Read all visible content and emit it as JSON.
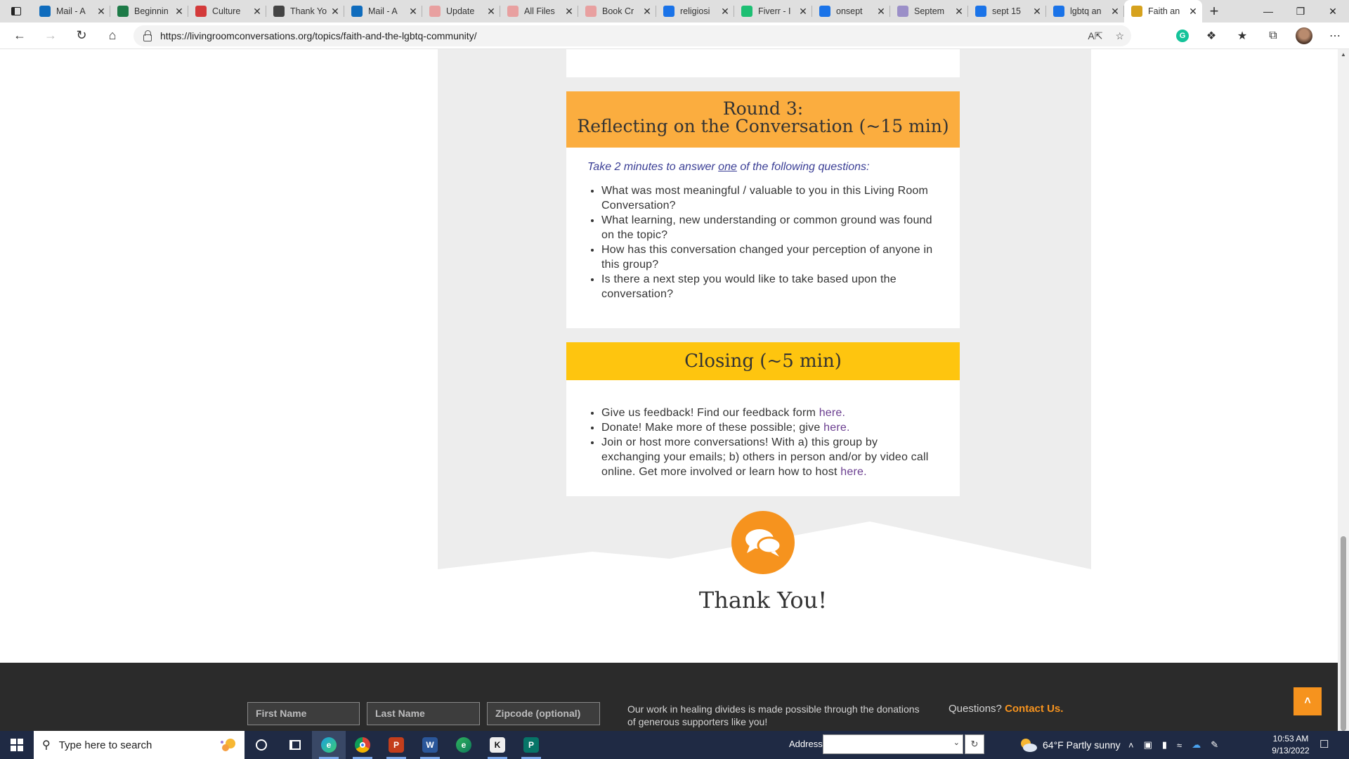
{
  "browser": {
    "tabs": [
      {
        "title": "Mail - A",
        "icon": "outlook-icon",
        "color": "#0f6cbd"
      },
      {
        "title": "Beginnin",
        "icon": "excel-icon",
        "color": "#1d7a47"
      },
      {
        "title": "Culture",
        "icon": "red-icon",
        "color": "#d33a3a"
      },
      {
        "title": "Thank Yo",
        "icon": "amazon-icon",
        "color": "#444444"
      },
      {
        "title": "Mail - A",
        "icon": "outlook-icon",
        "color": "#0f6cbd"
      },
      {
        "title": "Update",
        "icon": "pink-icon",
        "color": "#e8a0a0"
      },
      {
        "title": "All Files",
        "icon": "pink-icon",
        "color": "#e8a0a0"
      },
      {
        "title": "Book Cr",
        "icon": "pink-icon",
        "color": "#e8a0a0"
      },
      {
        "title": "religiosi",
        "icon": "search-icon",
        "color": "#1a73e8"
      },
      {
        "title": "Fiverr - I",
        "icon": "fiverr-icon",
        "color": "#1dbf73"
      },
      {
        "title": "onsept",
        "icon": "search-icon",
        "color": "#1a73e8"
      },
      {
        "title": "Septem",
        "icon": "graph-icon",
        "color": "#9b8fc8"
      },
      {
        "title": "sept 15",
        "icon": "search-icon",
        "color": "#1a73e8"
      },
      {
        "title": "lgbtq an",
        "icon": "search-icon",
        "color": "#1a73e8"
      },
      {
        "title": "Faith an",
        "icon": "lrc-icon",
        "color": "#d6a21e",
        "active": true
      }
    ],
    "new_tab": "+",
    "url": "https://livingroomconversations.org/topics/faith-and-the-lgbtq-community/"
  },
  "round3": {
    "heading_line1": "Round 3:",
    "heading_line2": "Reflecting on the Conversation (~15 min)",
    "instruction_pre": "Take 2 minutes to answer ",
    "instruction_em": "one",
    "instruction_post": " of the following questions:",
    "questions": [
      "What was most meaningful / valuable to you in this Living Room Conversation?",
      "What learning, new understanding or common ground was found on the topic?",
      "How has this conversation changed your perception of anyone in this group?",
      "Is there a next step you would like to take based upon the conversation?"
    ]
  },
  "closing": {
    "heading": "Closing (~5 min)",
    "item1_text": "Give us feedback! Find our feedback form ",
    "item2_text": "Donate! Make more of these possible; give ",
    "item3_text": "Join or host more conversations! With a) this group by exchanging your emails; b) others in person and/or by video call online. Get more involved or learn how to host ",
    "link": "here",
    "period": "."
  },
  "thanks": "Thank You!",
  "footer": {
    "first_name": "First Name",
    "last_name": "Last Name",
    "zipcode": "Zipcode (optional)",
    "note": "Our work in healing divides is made possible through the donations of generous supporters like you!",
    "questions": "Questions?",
    "contact": "Contact Us."
  },
  "taskbar": {
    "search": "Type here to search",
    "address_label": "Address",
    "weather": "64°F  Partly sunny",
    "time": "10:53 AM",
    "date": "9/13/2022"
  },
  "colors": {
    "round3_header": "#fbad3f",
    "closing_header": "#fec50f",
    "accent_orange": "#f6931e",
    "link_purple": "#6a3d8f",
    "instruction_blue": "#3a3e95"
  }
}
